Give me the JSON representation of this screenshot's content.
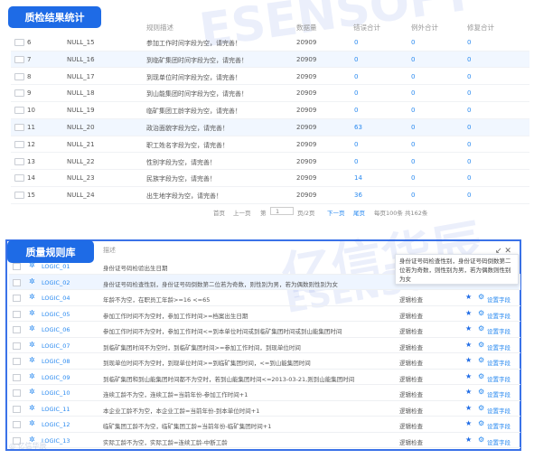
{
  "top_panel": {
    "title": "质检结果统计",
    "columns": [
      "规则描述",
      "数据量",
      "错误合计",
      "例外合计",
      "修复合计"
    ],
    "rows": [
      {
        "id": "6",
        "code": "NULL_15",
        "desc": "参加工作时间字段为空，请完善！",
        "count": "20909",
        "err": "0",
        "exc": "0",
        "fix": "0"
      },
      {
        "id": "7",
        "code": "NULL_16",
        "desc": "到临矿集团时间字段为空，请完善！",
        "count": "20909",
        "err": "0",
        "exc": "0",
        "fix": "0"
      },
      {
        "id": "8",
        "code": "NULL_17",
        "desc": "到现单位时间字段为空，请完善！",
        "count": "20909",
        "err": "0",
        "exc": "0",
        "fix": "0"
      },
      {
        "id": "9",
        "code": "NULL_18",
        "desc": "到山能集团时间字段为空，请完善！",
        "count": "20909",
        "err": "0",
        "exc": "0",
        "fix": "0"
      },
      {
        "id": "10",
        "code": "NULL_19",
        "desc": "临矿集团工龄字段为空，请完善！",
        "count": "20909",
        "err": "0",
        "exc": "0",
        "fix": "0"
      },
      {
        "id": "11",
        "code": "NULL_20",
        "desc": "政治面貌字段为空，请完善！",
        "count": "20909",
        "err": "63",
        "exc": "0",
        "fix": "0"
      },
      {
        "id": "12",
        "code": "NULL_21",
        "desc": "职工姓名字段为空，请完善！",
        "count": "20909",
        "err": "0",
        "exc": "0",
        "fix": "0"
      },
      {
        "id": "13",
        "code": "NULL_22",
        "desc": "性别字段为空，请完善！",
        "count": "20909",
        "err": "0",
        "exc": "0",
        "fix": "0"
      },
      {
        "id": "14",
        "code": "NULL_23",
        "desc": "民族字段为空，请完善！",
        "count": "20909",
        "err": "14",
        "exc": "0",
        "fix": "0"
      },
      {
        "id": "15",
        "code": "NULL_24",
        "desc": "出生地字段为空，请完善！",
        "count": "20909",
        "err": "36",
        "exc": "0",
        "fix": "0"
      }
    ],
    "pager": {
      "first": "首页",
      "prev": "上一页",
      "goto": "第",
      "page_input": "1",
      "of_pages": "页/2页",
      "next": "下一页",
      "last": "尾页",
      "summary": "每页100条 共162条"
    }
  },
  "bottom_panel": {
    "title": "质量规则库",
    "column_desc": "描述",
    "tooltip": "身份证号码检查性别，身份证号码倒数第二位若为奇数，则性别为男，若为偶数则性别为女",
    "rows": [
      {
        "code": "LOGIC_01",
        "desc": "身份证号码检验出生日期",
        "type": "",
        "link": ""
      },
      {
        "code": "LOGIC_02",
        "desc": "身份证号码检查性别，身份证号码倒数第二位若为奇数，则性别为男，若为偶数则性别为女",
        "type": "",
        "link": ""
      },
      {
        "code": "LOGIC_04",
        "desc": "年龄不为空，在职员工年龄>=16 <=65",
        "type": "逻辑检查",
        "link": "设置字段"
      },
      {
        "code": "LOGIC_05",
        "desc": "参加工作时间不为空时，参加工作时间>=档案出生日期",
        "type": "逻辑检查",
        "link": "设置字段"
      },
      {
        "code": "LOGIC_06",
        "desc": "参加工作时间不为空时，参加工作时间<=到本单位时间或到临矿集团时间或到山能集团时间",
        "type": "逻辑检查",
        "link": "设置字段"
      },
      {
        "code": "LOGIC_07",
        "desc": "到临矿集团时间不为空时，到临矿集团时间>=参加工作时间，到现单位时间",
        "type": "逻辑检查",
        "link": "设置字段"
      },
      {
        "code": "LOGIC_08",
        "desc": "到现单位时间不为空时，到现单位时间>=到临矿集团时间，<=到山能集团时间",
        "type": "逻辑检查",
        "link": "设置字段"
      },
      {
        "code": "LOGIC_09",
        "desc": "到临矿集团和到山能集团时间都不为空时，若到山能集团时间<=2013-03-21,则到山能集团时间",
        "type": "逻辑检查",
        "link": "设置字段"
      },
      {
        "code": "LOGIC_10",
        "desc": "连续工龄不为空，连续工龄=当前年份-参加工作时间+1",
        "type": "逻辑检查",
        "link": "设置字段"
      },
      {
        "code": "LOGIC_11",
        "desc": "本企业工龄不为空，本企业工龄=当前年份-到本单位时间+1",
        "type": "逻辑检查",
        "link": "设置字段"
      },
      {
        "code": "LOGIC_12",
        "desc": "临矿集团工龄不为空，临矿集团工龄=当前年份-临矿集团时间+1",
        "type": "逻辑检查",
        "link": "设置字段"
      },
      {
        "code": "LOGIC_13",
        "desc": "实际工龄不为空，实际工龄=连续工龄-中断工龄",
        "type": "逻辑检查",
        "link": "设置字段"
      }
    ]
  },
  "watermarks": [
    "ESENSOFT",
    "亿信华辰",
    "ESENSOFT"
  ],
  "logo_bottom": "亿信华辰",
  "colors": {
    "accent": "#1e6be6",
    "link": "#2a8af0"
  }
}
